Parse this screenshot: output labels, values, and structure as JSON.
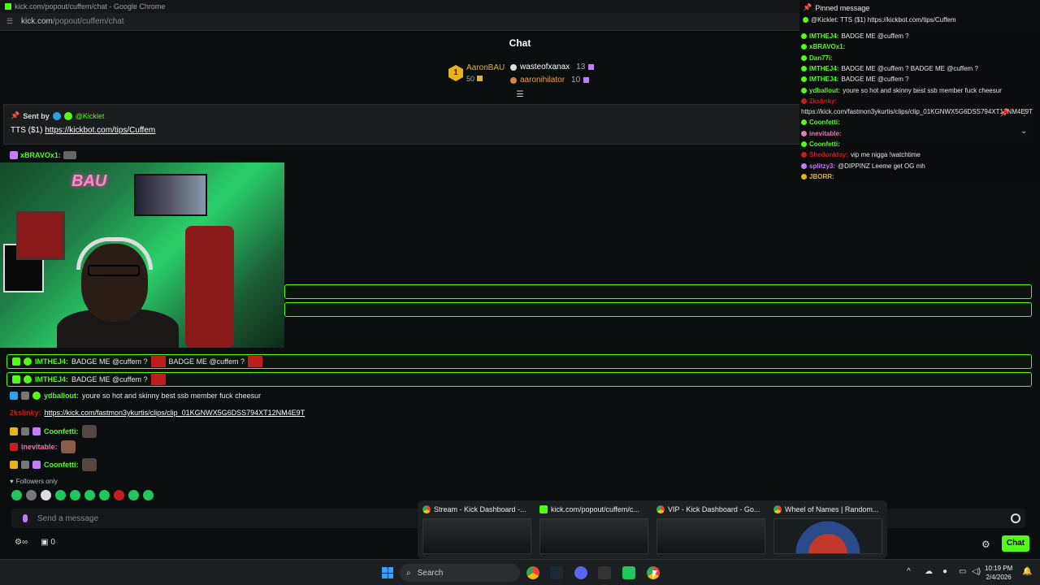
{
  "browser": {
    "window_title": "kick.com/popout/cuffem/chat - Google Chrome",
    "url_host": "kick.com",
    "url_path": "/popout/cuffem/chat"
  },
  "chat": {
    "header": "Chat",
    "leaderboard": {
      "first": {
        "rank": "1",
        "name": "AaronBAU",
        "count": "50"
      },
      "second": {
        "name": "wasteofxanax",
        "count": "13"
      },
      "third": {
        "name": "aaronihilator",
        "count": "10"
      }
    },
    "pinned": {
      "sent_by_label": "Sent by",
      "sent_by_user": "@Kicklet",
      "text_prefix": "TTS ($1) ",
      "link": "https://kickbot.com/tips/Cuffem"
    },
    "bravo": {
      "user": "xBRAVOx1:"
    },
    "messages": [
      {
        "user": "IMTHEJ4:",
        "color": "#53fc18",
        "text": "BADGE ME @cuffem ?",
        "text2": "BADGE ME @cuffem ?"
      },
      {
        "user": "IMTHEJ4:",
        "color": "#53fc18",
        "text": "BADGE ME @cuffem ?"
      },
      {
        "user": "ydballout:",
        "color": "#53fc18",
        "text": "youre so hot and skinny best ssb member fuck cheesur"
      },
      {
        "user": "2kslinky:",
        "color": "#c41e1e",
        "link": "https://kick.com/fastmon3ykurtis/clips/clip_01KGNWX5G6DSS794XT12NM4E9T"
      },
      {
        "user": "Coonfetti:",
        "color": "#53fc18"
      },
      {
        "user": "inevitable:",
        "color": "#e87ab0"
      },
      {
        "user": "Coonfetti:",
        "color": "#53fc18"
      }
    ],
    "followers_only": "Followers only",
    "send_placeholder": "Send a message",
    "points": "0",
    "chat_button": "Chat"
  },
  "overlay": {
    "title": "Pinned message",
    "pinned_line": "@Kicklet: TTS ($1) https://kickbot.com/tips/Cuffem",
    "lines": [
      {
        "user": "IMTHEJ4:",
        "color": "#53fc18",
        "text": "BADGE ME @cuffem ?"
      },
      {
        "user": "xBRAVOx1:",
        "color": "#53fc18",
        "text": ""
      },
      {
        "user": "Dan77i:",
        "color": "#53fc18",
        "text": ""
      },
      {
        "user": "IMTHEJ4:",
        "color": "#53fc18",
        "text": "BADGE ME @cuffem ? BADGE ME @cuffem ?"
      },
      {
        "user": "IMTHEJ4:",
        "color": "#53fc18",
        "text": "BADGE ME @cuffem ?"
      },
      {
        "user": "ydballout:",
        "color": "#53fc18",
        "text": "youre so hot and skinny best ssb member fuck cheesur"
      },
      {
        "user": "2kslinky:",
        "color": "#c41e1e",
        "text": ""
      },
      {
        "user": "",
        "color": "#ffffff",
        "text": "https://kick.com/fastmon3ykurtis/clips/clip_01KGNWX5G6DSS794XT12NM4E9T"
      },
      {
        "user": "Coonfetti:",
        "color": "#53fc18",
        "text": ""
      },
      {
        "user": "inevitable:",
        "color": "#e87ab0",
        "text": ""
      },
      {
        "user": "Coonfetti:",
        "color": "#53fc18",
        "text": ""
      },
      {
        "user": "Shedonlday:",
        "color": "#c41e1e",
        "text": "vip me nigga !watchtime"
      },
      {
        "user": "splitzy3:",
        "color": "#c47bff",
        "text": "@DIPPINZ Leeme get OG mh"
      },
      {
        "user": "JBORR:",
        "color": "#e8b21e",
        "text": ""
      }
    ]
  },
  "tasks": [
    {
      "title": "Stream - Kick Dashboard -..."
    },
    {
      "title": "kick.com/popout/cuffem/c..."
    },
    {
      "title": "VIP - Kick Dashboard - Go..."
    },
    {
      "title": "Wheel of Names | Random..."
    }
  ],
  "taskbar": {
    "search": "Search",
    "time": "10:19 PM",
    "date": "2/4/2026"
  }
}
